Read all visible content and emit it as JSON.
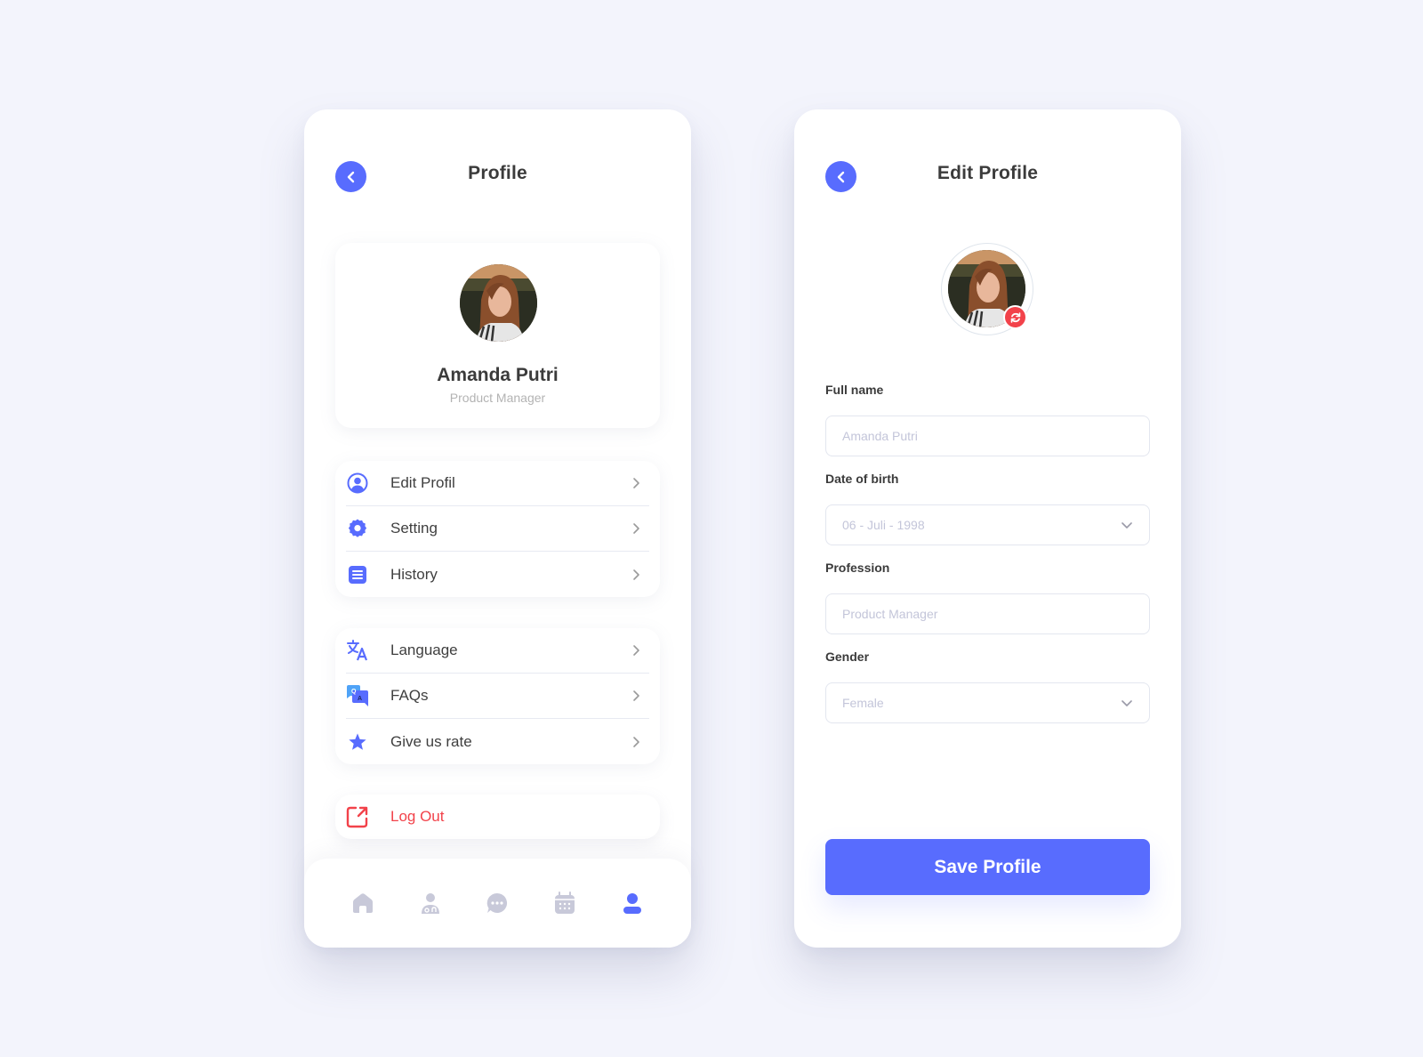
{
  "colors": {
    "accent": "#586cfe",
    "danger": "#f2424a",
    "background": "#f3f4fc",
    "muted_icon": "#c8c9d9"
  },
  "profile_screen": {
    "header": {
      "title": "Profile",
      "back_icon": "chevron-left-icon"
    },
    "user": {
      "name": "Amanda Putri",
      "role": "Product Manager",
      "avatar": "profile-photo"
    },
    "menu_groups": [
      {
        "items": [
          {
            "label": "Edit Profil",
            "icon": "user-circle-icon"
          },
          {
            "label": "Setting",
            "icon": "gear-icon"
          },
          {
            "label": "History",
            "icon": "list-icon"
          }
        ]
      },
      {
        "items": [
          {
            "label": "Language",
            "icon": "translate-icon"
          },
          {
            "label": "FAQs",
            "icon": "qa-chat-icon"
          },
          {
            "label": "Give us rate",
            "icon": "star-icon"
          }
        ]
      }
    ],
    "logout": {
      "label": "Log Out",
      "icon": "external-link-icon"
    },
    "bottom_nav": [
      {
        "name": "home",
        "icon": "home-icon",
        "active": false
      },
      {
        "name": "doctor",
        "icon": "doctor-icon",
        "active": false
      },
      {
        "name": "chat",
        "icon": "chat-icon",
        "active": false
      },
      {
        "name": "calendar",
        "icon": "calendar-icon",
        "active": false
      },
      {
        "name": "profile",
        "icon": "user-icon",
        "active": true
      }
    ]
  },
  "edit_profile_screen": {
    "header": {
      "title": "Edit Profile",
      "back_icon": "chevron-left-icon"
    },
    "avatar": {
      "image": "profile-photo",
      "change_icon": "refresh-icon"
    },
    "fields": {
      "full_name": {
        "label": "Full name",
        "placeholder": "Amanda Putri"
      },
      "date_of_birth": {
        "label": "Date of birth",
        "value": "06 - Juli - 1998"
      },
      "profession": {
        "label": "Profession",
        "placeholder": "Product Manager"
      },
      "gender": {
        "label": "Gender",
        "value": "Female"
      }
    },
    "save_button": {
      "label": "Save Profile"
    }
  }
}
